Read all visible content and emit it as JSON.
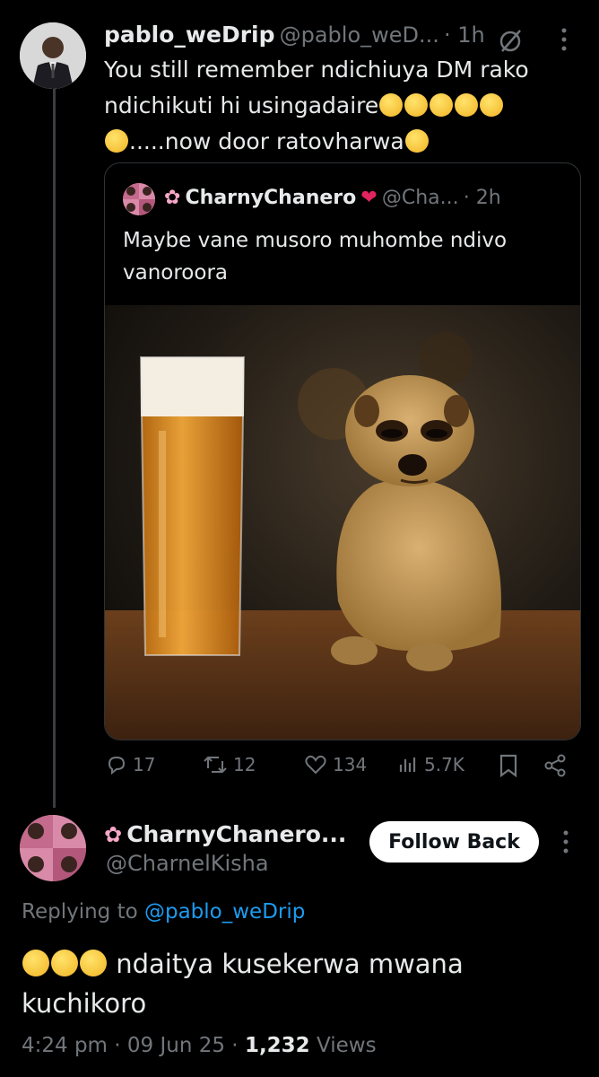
{
  "colors": {
    "background": "#000000",
    "text": "#e7e9ea",
    "muted": "#71767b",
    "link": "#1d9bf0",
    "heart": "#e0245e"
  },
  "top_tweet": {
    "display_name": "pablo_weDrip",
    "handle": "@pablo_weD...",
    "time": "· 1h",
    "text_line1": "You still remember ndichiuya DM rako",
    "text_line2": "ndichikuti hi usingadaire",
    "text_line3": ".....now door ratovharwa",
    "more_icon": "more-vertical-icon",
    "grok_icon": "slashed-circle-icon"
  },
  "quote_tweet": {
    "display_name": "CharnyChanero",
    "handle": "@Cha...",
    "time": "· 2h",
    "text_line1": "Maybe vane musoro muhombe ndivo",
    "text_line2": "vanoroora"
  },
  "actions": {
    "replies": "17",
    "retweets": "12",
    "likes": "134",
    "views": "5.7K"
  },
  "reply": {
    "display_name": "CharnyChanero...",
    "handle": "@CharnelKisha",
    "follow_label": "Follow Back",
    "replying_prefix": "Replying to",
    "replying_handle": "@pablo_weDrip",
    "text_line1": "ndaitya kusekerwa mwana",
    "text_line2": "kuchikoro",
    "timestamp": "4:24 pm · 09 Jun 25 ·",
    "view_count": "1,232",
    "views_label": "Views"
  }
}
